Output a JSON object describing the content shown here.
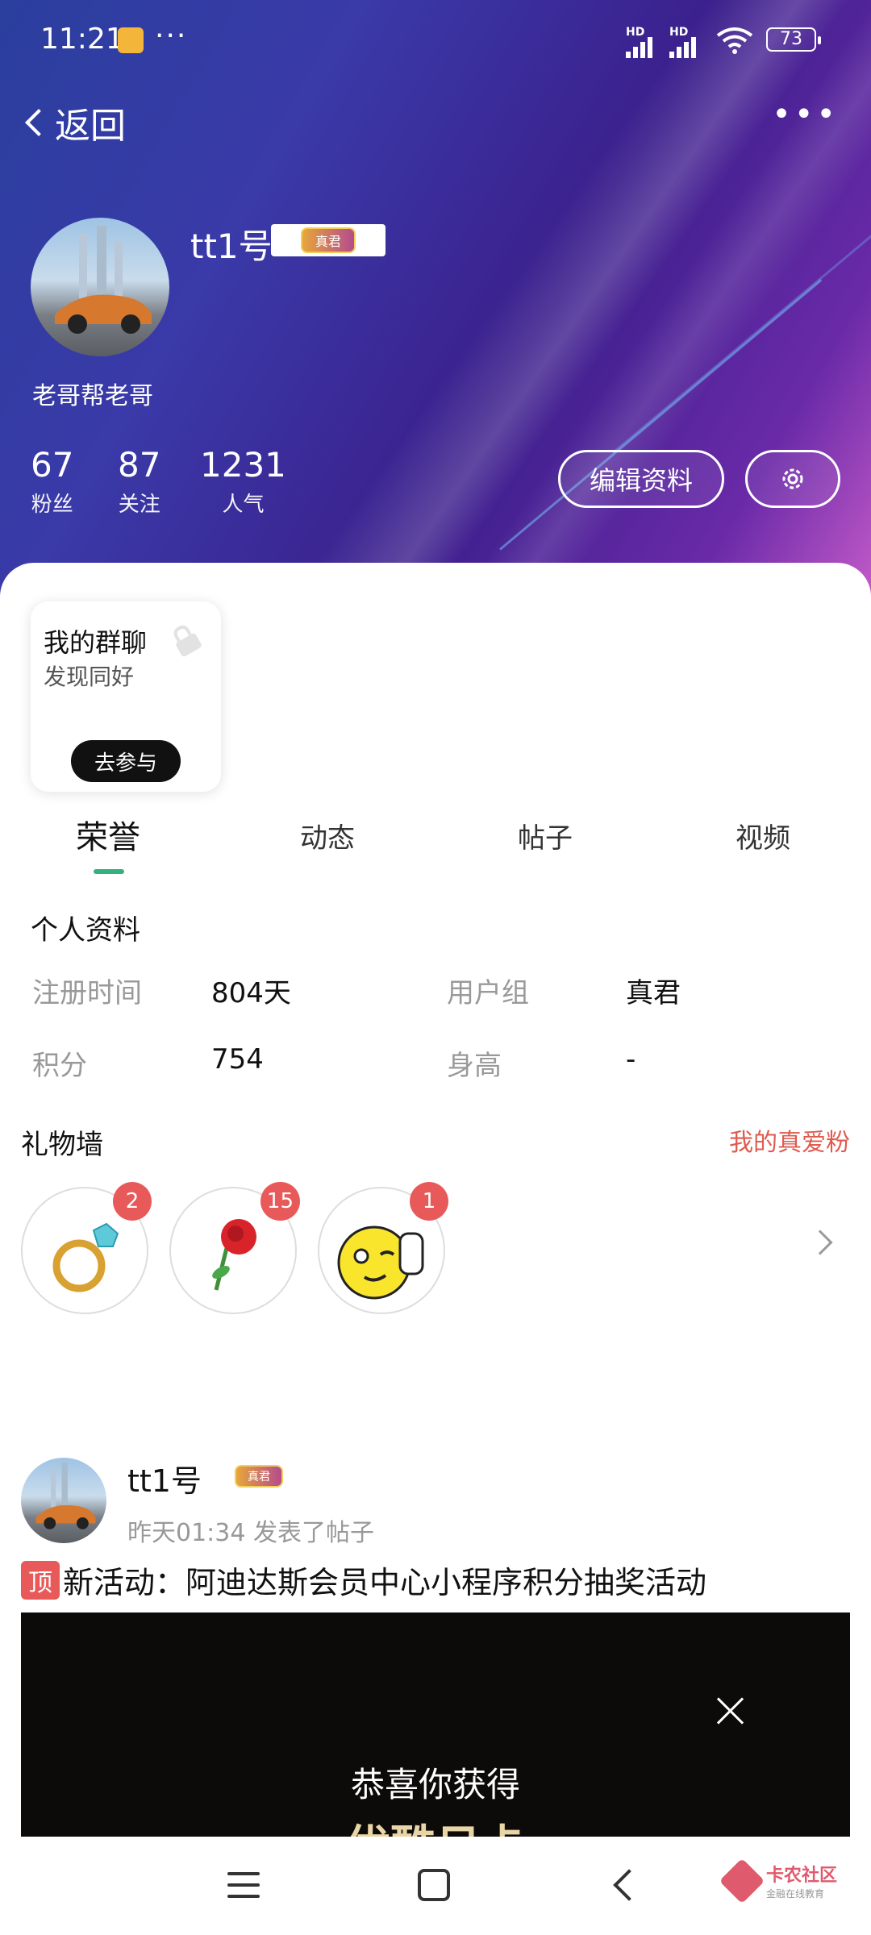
{
  "status_bar": {
    "time": "11:21",
    "more": "···",
    "signal_hd_1": "HD",
    "signal_hd_2": "HD",
    "battery": "73"
  },
  "nav": {
    "back_label": "返回",
    "more": "•••"
  },
  "profile": {
    "username": "tt1号",
    "badge_text": "真君",
    "signature": "老哥帮老哥",
    "stats": [
      {
        "num": "67",
        "label": "粉丝"
      },
      {
        "num": "87",
        "label": "关注"
      },
      {
        "num": "1231",
        "label": "人气"
      }
    ],
    "edit_button": "编辑资料"
  },
  "group_card": {
    "title": "我的群聊",
    "subtitle": "发现同好",
    "join_button": "去参与"
  },
  "tabs": [
    {
      "label": "荣誉",
      "active": true
    },
    {
      "label": "动态",
      "active": false
    },
    {
      "label": "帖子",
      "active": false
    },
    {
      "label": "视频",
      "active": false
    }
  ],
  "personal_info": {
    "title": "个人资料",
    "reg_time_label": "注册时间",
    "reg_time_value": "804天",
    "user_group_label": "用户组",
    "user_group_value": "真君",
    "points_label": "积分",
    "points_value": "754",
    "height_label": "身高",
    "height_value": "-"
  },
  "gift_wall": {
    "title": "礼物墙",
    "link": "我的真爱粉",
    "gifts": [
      {
        "icon": "ring-icon",
        "count": "2"
      },
      {
        "icon": "rose-icon",
        "count": "15"
      },
      {
        "icon": "thumbs-up-emoji-icon",
        "count": "1"
      }
    ]
  },
  "post": {
    "user": "tt1号",
    "badge_text": "真君",
    "meta": "昨天01:34  发表了帖子",
    "pin_label": "顶",
    "title": "新活动：阿迪达斯会员中心小程序积分抽奖活动",
    "image_text": "恭喜你获得",
    "image_text_cut": "优酷日卡"
  },
  "watermark": {
    "main": "卡农社区",
    "sub": "金融在线教育"
  },
  "colors": {
    "accent_green": "#37b07f",
    "link_red": "#e05a4e",
    "badge_red": "#e85a5a"
  }
}
